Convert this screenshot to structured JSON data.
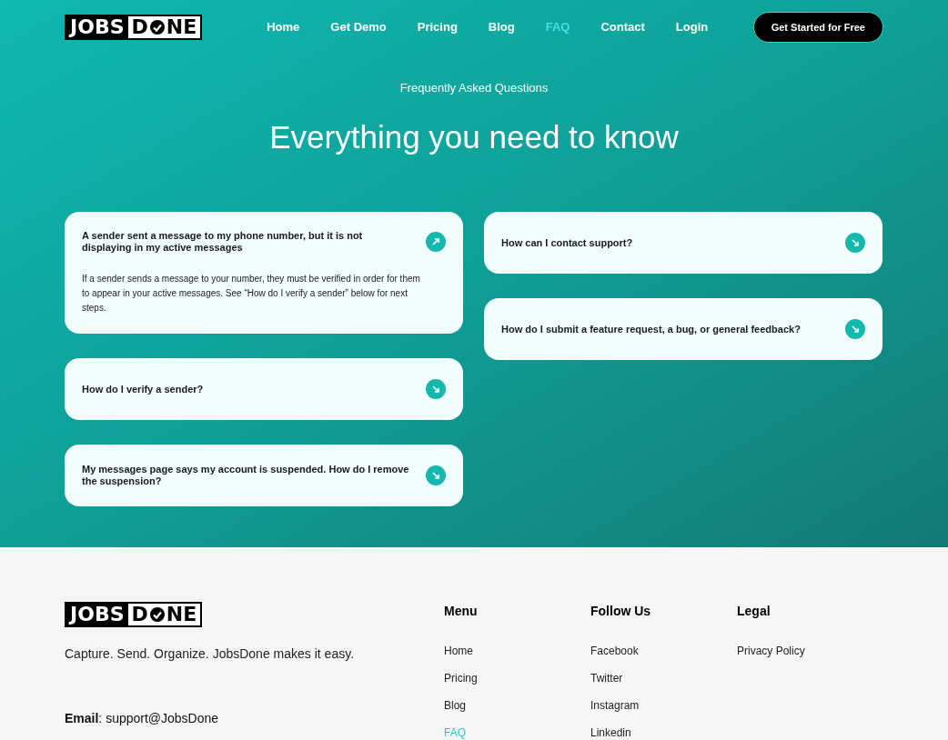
{
  "logo": {
    "left": "JOBS",
    "right_start": "D",
    "right_end": "NE"
  },
  "nav": [
    {
      "label": "Home",
      "selected": false
    },
    {
      "label": "Get Demo",
      "selected": false
    },
    {
      "label": "Pricing",
      "selected": false
    },
    {
      "label": "Blog",
      "selected": false
    },
    {
      "label": "FAQ",
      "selected": true
    },
    {
      "label": "Contact",
      "selected": false
    },
    {
      "label": "Login",
      "selected": false
    }
  ],
  "cta": "Get Started for Free",
  "eyebrow": "Frequently Asked Questions",
  "heading": "Everything you need to know",
  "faq_columns": [
    [
      {
        "question": "A sender sent a message to my phone number, but it is not displaying in my active messages",
        "expanded": true,
        "answer": "If a sender sends a message to your number, they must be verified in order for them to appear in your active messages. See “How do I verify a sender” below for next steps."
      },
      {
        "question": "How do I verify a sender?",
        "expanded": false
      },
      {
        "question": "My messages page says my account is suspended. How do I remove the suspension?",
        "expanded": false
      }
    ],
    [
      {
        "question": "How can I contact support?",
        "expanded": false
      },
      {
        "question": "How do I submit a feature request, a bug, or general feedback?",
        "expanded": false
      }
    ]
  ],
  "footer": {
    "logo": {
      "left": "JOBS",
      "right_start": "D",
      "right_end": "NE"
    },
    "tagline": "Capture. Send. Organize. JobsDone makes it easy.",
    "email_label": "Email",
    "email": ": support@JobsDone",
    "columns": [
      {
        "title": "Menu",
        "links": [
          {
            "label": "Home",
            "selected": false
          },
          {
            "label": "Pricing",
            "selected": false
          },
          {
            "label": "Blog",
            "selected": false
          },
          {
            "label": "FAQ",
            "selected": true
          }
        ]
      },
      {
        "title": "Follow Us",
        "links": [
          {
            "label": "Facebook",
            "selected": false
          },
          {
            "label": "Twitter",
            "selected": false
          },
          {
            "label": "Instagram",
            "selected": false
          },
          {
            "label": "Linkedin",
            "selected": false
          }
        ]
      },
      {
        "title": "Legal",
        "links": [
          {
            "label": "Privacy Policy",
            "selected": false
          }
        ]
      }
    ]
  }
}
